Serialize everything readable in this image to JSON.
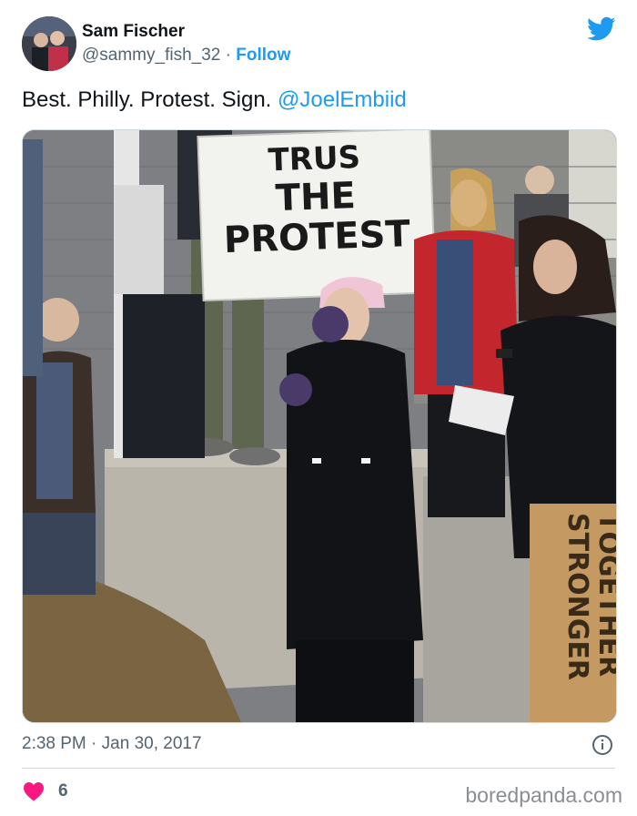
{
  "author": {
    "name": "Sam Fischer",
    "handle": "@sammy_fish_32",
    "separator": "·",
    "follow_label": "Follow"
  },
  "tweet": {
    "text": "Best. Philly. Protest. Sign. ",
    "mention": "@JoelEmbiid"
  },
  "photo": {
    "sign_lines": [
      "TRUS",
      "THE",
      "PROTEST"
    ],
    "cardboard_lines": [
      "STRONGER",
      "TOGETHER"
    ]
  },
  "meta": {
    "time": "2:38 PM",
    "separator": "·",
    "date": "Jan 30, 2017"
  },
  "engagement": {
    "likes": "6"
  },
  "watermark": "boredpanda.com",
  "colors": {
    "accent": "#1d9bf0",
    "heart": "#f91880",
    "muted_text": "#536471"
  },
  "icons": [
    "twitter-bird-icon",
    "info-icon",
    "heart-icon"
  ]
}
